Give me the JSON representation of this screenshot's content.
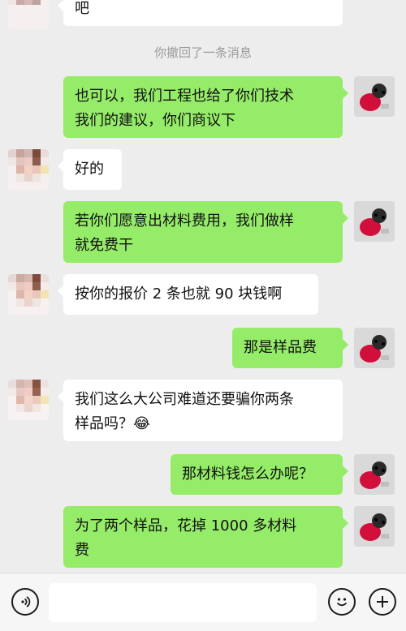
{
  "messages": {
    "m1": "吧",
    "m2": "也可以，我们工程也给了你们技术\n我们的建议，你们商议下",
    "m3": "好的",
    "m4": "若你们愿意出材料费用，我们做样\n就免费干",
    "m5": "按你的报价 2 条也就 90 块钱啊",
    "m6": "那是样品费",
    "m7": "我们这么大公司难道还要骗你两条\n样品吗？😂",
    "m8": "那材料钱怎么办呢？",
    "m9": "为了两个样品，花掉 1000 多材料\n费"
  },
  "system_notice": "你撤回了一条消息",
  "input": {
    "placeholder": ""
  },
  "colors": {
    "sent_bubble": "#95ec69",
    "received_bubble": "#ffffff",
    "background": "#ededed"
  },
  "icons": {
    "voice": "voice-icon",
    "emoji": "emoji-icon",
    "more": "plus-icon"
  }
}
